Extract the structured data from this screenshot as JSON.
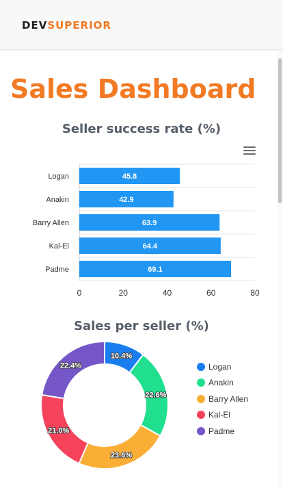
{
  "brand": {
    "part1": "DEV",
    "part2": "SUPERIOR"
  },
  "page_title": "Sales Dashboard",
  "colors": {
    "accent": "#f27a24",
    "bar": "#2196f3",
    "pie": [
      "#1a7ef0",
      "#20df8e",
      "#fbae36",
      "#f6435c",
      "#7456c6"
    ]
  },
  "icons": {
    "menu": "hamburger-menu-icon"
  },
  "chart_data": [
    {
      "type": "bar",
      "orientation": "horizontal",
      "title": "Seller success rate (%)",
      "categories": [
        "Logan",
        "Anakin",
        "Barry Allen",
        "Kal-El",
        "Padme"
      ],
      "values": [
        45.8,
        42.9,
        63.9,
        64.4,
        69.1
      ],
      "value_labels": [
        "45.8",
        "42.9",
        "63.9",
        "64.4",
        "69.1"
      ],
      "xlim": [
        0,
        80
      ],
      "x_ticks": [
        0,
        20,
        40,
        60,
        80
      ],
      "xlabel": "",
      "ylabel": "",
      "grid": true
    },
    {
      "type": "pie",
      "style": "donut",
      "title": "Sales per seller (%)",
      "labels": [
        "Logan",
        "Anakin",
        "Barry Allen",
        "Kal-El",
        "Padme"
      ],
      "values": [
        10.4,
        22.6,
        23.6,
        21.0,
        22.4
      ],
      "value_labels": [
        "10.4%",
        "22.6%",
        "23.6%",
        "21.0%",
        "22.4%"
      ],
      "legend": "right"
    }
  ]
}
